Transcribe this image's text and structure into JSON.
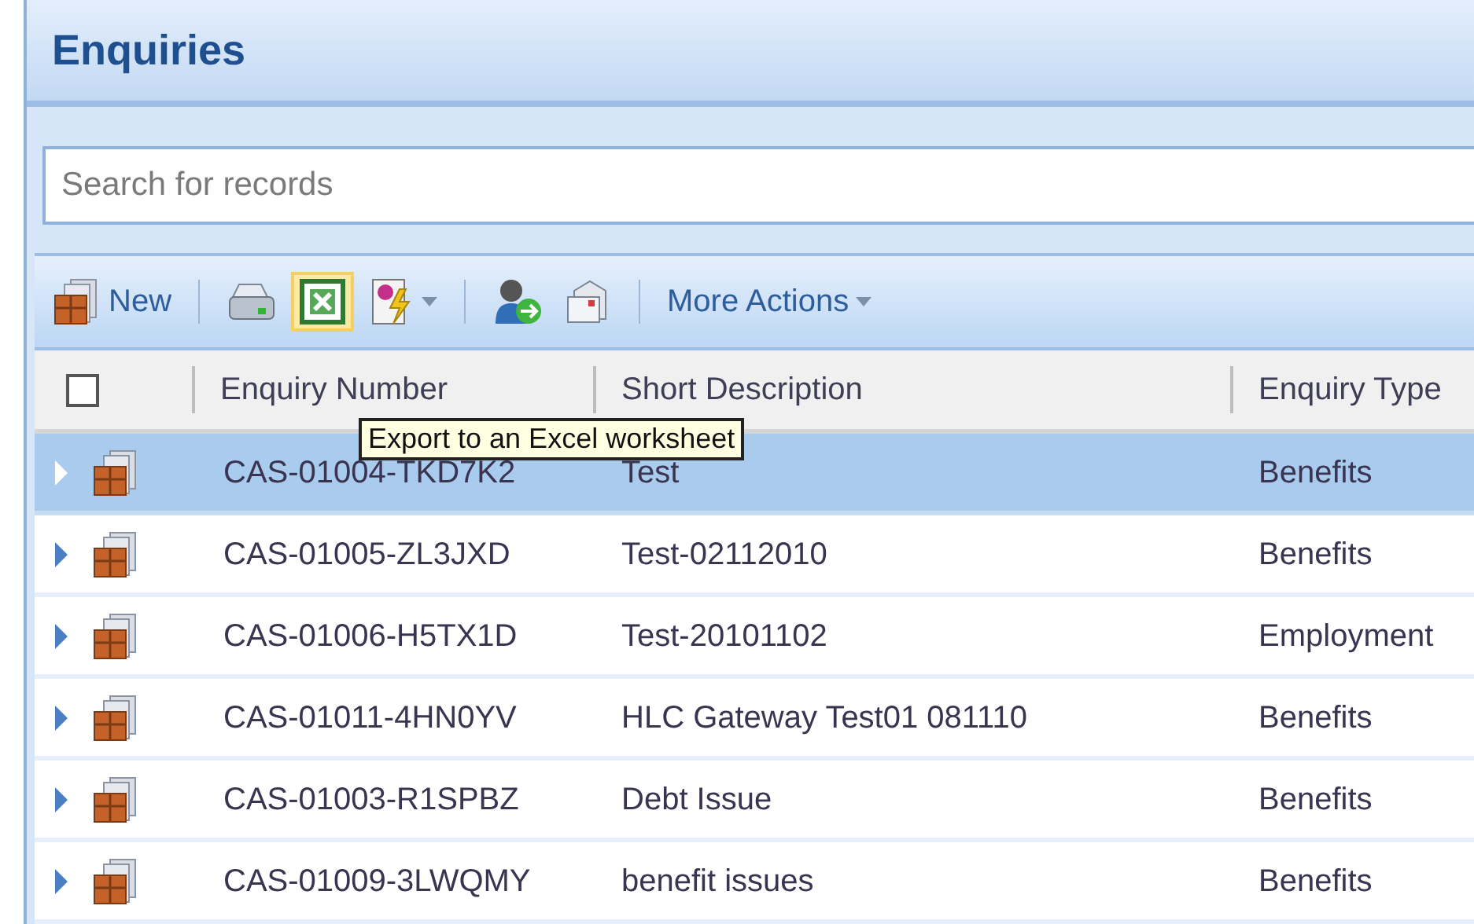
{
  "title": "Enquiries",
  "search": {
    "placeholder": "Search for records"
  },
  "toolbar": {
    "groups": [
      [
        {
          "label": "New",
          "highlighted": false,
          "dropdown": false
        }
      ],
      [
        {
          "highlighted": false,
          "dropdown": false
        },
        {
          "highlighted": true,
          "dropdown": false
        },
        {
          "highlighted": false,
          "dropdown": true
        }
      ],
      [
        {
          "highlighted": false,
          "dropdown": false
        },
        {
          "highlighted": false,
          "dropdown": false
        }
      ],
      [
        {
          "label": "More Actions",
          "highlighted": false,
          "dropdown": true
        }
      ]
    ]
  },
  "tooltip": {
    "text": "Export to an Excel worksheet"
  },
  "table": {
    "select_all": {
      "checked": false
    },
    "columns": [
      "Enquiry Number",
      "Short Description",
      "Enquiry Type"
    ],
    "rows": [
      {
        "selected": true,
        "cells": [
          "CAS-01004-TKD7K2",
          "Test",
          "Benefits"
        ]
      },
      {
        "selected": false,
        "cells": [
          "CAS-01005-ZL3JXD",
          "Test-02112010",
          "Benefits"
        ]
      },
      {
        "selected": false,
        "cells": [
          "CAS-01006-H5TX1D",
          "Test-20101102",
          "Employment"
        ]
      },
      {
        "selected": false,
        "cells": [
          "CAS-01011-4HN0YV",
          "HLC Gateway Test01 081110",
          "Benefits"
        ]
      },
      {
        "selected": false,
        "cells": [
          "CAS-01003-R1SPBZ",
          "Debt Issue",
          "Benefits"
        ]
      },
      {
        "selected": false,
        "cells": [
          "CAS-01009-3LWQMY",
          "benefit issues",
          "Benefits"
        ]
      }
    ]
  }
}
